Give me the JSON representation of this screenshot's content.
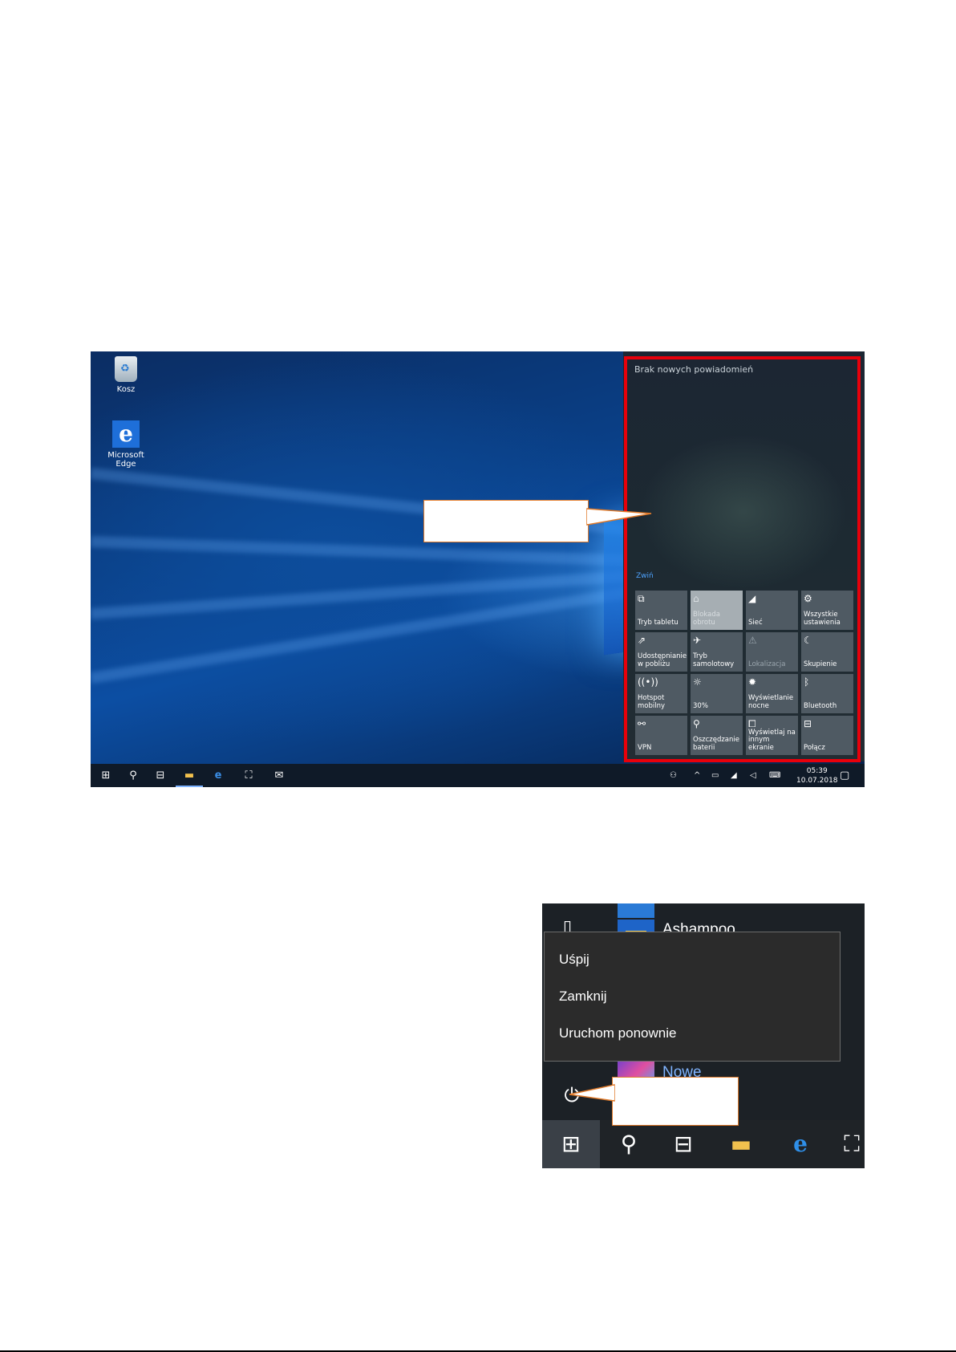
{
  "desktop": {
    "icons": [
      {
        "label": "Kosz",
        "icon": "recycle-bin-icon"
      },
      {
        "label": "Microsoft Edge",
        "icon": "edge-icon"
      }
    ]
  },
  "action_center": {
    "title": "Brak nowych powiadomień",
    "collapse_label": "Zwiń",
    "tiles": [
      {
        "label": "Tryb tabletu",
        "icon": "tablet-mode-icon",
        "glyph": "⧉",
        "state": "normal"
      },
      {
        "label": "Blokada obrotu",
        "icon": "rotation-lock-icon",
        "glyph": "⌂",
        "state": "active"
      },
      {
        "label": "Sieć",
        "icon": "network-icon",
        "glyph": "◢",
        "state": "normal"
      },
      {
        "label": "Wszystkie ustawienia",
        "icon": "settings-gear-icon",
        "glyph": "⚙",
        "state": "normal"
      },
      {
        "label": "Udostępnianie w pobliżu",
        "icon": "nearby-sharing-icon",
        "glyph": "⇗",
        "state": "normal"
      },
      {
        "label": "Tryb samolotowy",
        "icon": "airplane-icon",
        "glyph": "✈",
        "state": "normal"
      },
      {
        "label": "Lokalizacja",
        "icon": "location-icon",
        "glyph": "⚠",
        "state": "dim"
      },
      {
        "label": "Skupienie",
        "icon": "focus-assist-icon",
        "glyph": "☾",
        "state": "normal"
      },
      {
        "label": "Hotspot mobilny",
        "icon": "hotspot-icon",
        "glyph": "((•))",
        "state": "normal"
      },
      {
        "label": "30%",
        "icon": "brightness-icon",
        "glyph": "☼",
        "state": "normal"
      },
      {
        "label": "Wyświetlanie nocne",
        "icon": "night-light-icon",
        "glyph": "✹",
        "state": "normal"
      },
      {
        "label": "Bluetooth",
        "icon": "bluetooth-icon",
        "glyph": "ᛒ",
        "state": "normal"
      },
      {
        "label": "VPN",
        "icon": "vpn-icon",
        "glyph": "⚯",
        "state": "normal"
      },
      {
        "label": "Oszczędzanie baterii",
        "icon": "battery-saver-icon",
        "glyph": "⚲",
        "state": "normal"
      },
      {
        "label": "Wyświetlaj na innym ekranie",
        "icon": "project-icon",
        "glyph": "⧠",
        "state": "normal"
      },
      {
        "label": "Połącz",
        "icon": "connect-icon",
        "glyph": "⊟",
        "state": "normal"
      }
    ]
  },
  "taskbar1": {
    "time": "05:39",
    "date": "10.07.2018"
  },
  "start_menu": {
    "apps": [
      "Ashampoo",
      "Nowe"
    ],
    "power_menu": {
      "items": [
        "Uśpij",
        "Zamknij",
        "Uruchom ponownie"
      ]
    }
  },
  "colors": {
    "highlight_frame": "#e8000b",
    "callout_border": "#e07a2a",
    "accent_link": "#4ea3ff"
  }
}
